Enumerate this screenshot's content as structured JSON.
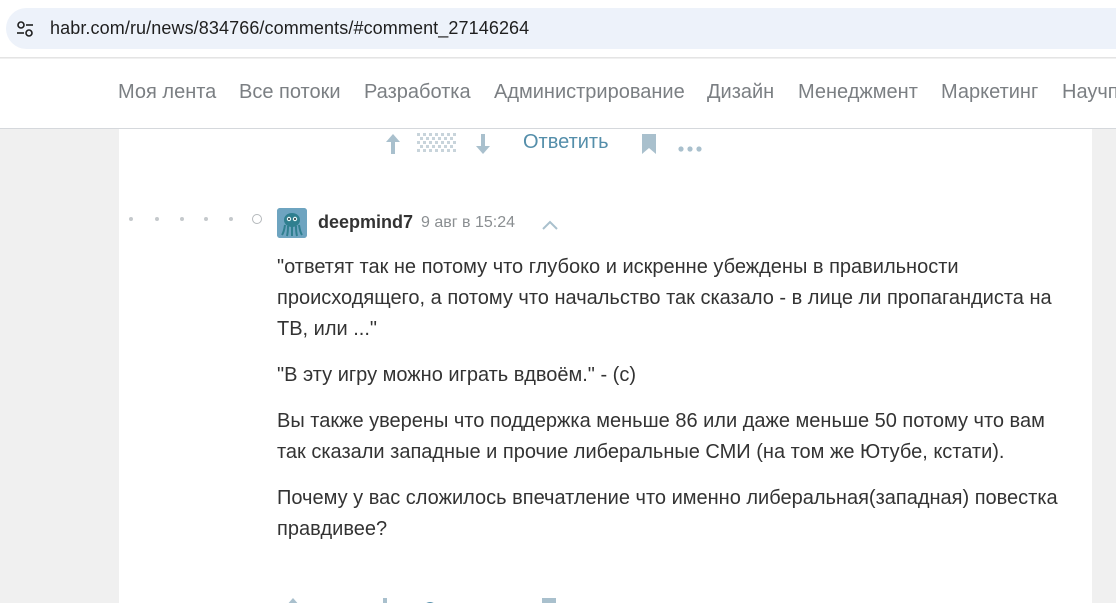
{
  "browser": {
    "url": "habr.com/ru/news/834766/comments/#comment_27146264",
    "site_info_icon": "tune-icon"
  },
  "nav": {
    "items": [
      "Моя лента",
      "Все потоки",
      "Разработка",
      "Администрирование",
      "Дизайн",
      "Менеджмент",
      "Маркетинг",
      "Научп"
    ]
  },
  "prev_comment_actions": {
    "upvote_icon": "arrow-up-icon",
    "score_icon": "hidden-score-icon",
    "downvote_icon": "arrow-down-icon",
    "reply_label": "Ответить",
    "bookmark_icon": "bookmark-icon",
    "more_icon": "more-dots-icon"
  },
  "comment": {
    "username": "deepmind7",
    "timestamp": "9 авг в 15:24",
    "paragraphs": [
      "\"ответят так не потому что глубоко и искренне убеждены в правильности происходящего, а потому что начальство так сказало - в лице ли пропагандиста на ТВ, или ...\"",
      "\"В эту игру можно играть вдвоём.\" - (с)",
      "Вы также уверены что поддержка меньше 86 или даже меньше 50 потому что вам так сказали западные и прочие либеральные СМИ (на том же Ютубе, кстати).",
      "Почему у вас сложилось впечатление что именно либеральная(западная) повестка правдивее?"
    ]
  },
  "colors": {
    "link": "#548eaa",
    "nav_text": "#7b7f83",
    "icon": "#a9c0cd"
  }
}
